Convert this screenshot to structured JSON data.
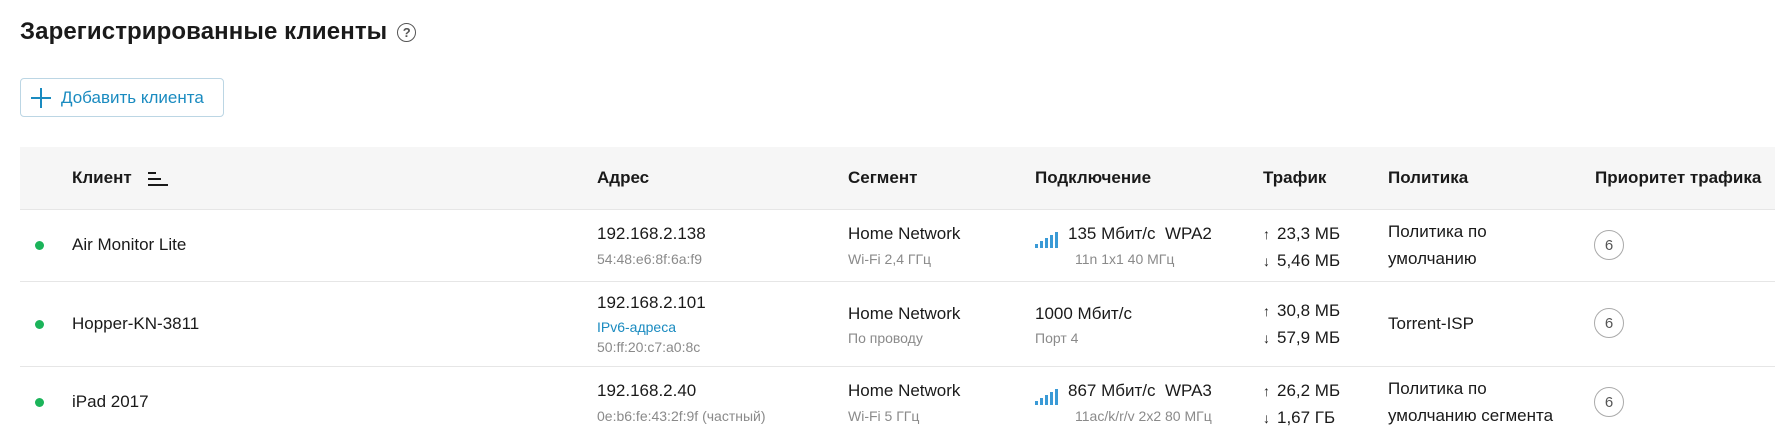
{
  "header": {
    "title": "Зарегистрированные клиенты",
    "help_icon": "question-circle-icon"
  },
  "toolbar": {
    "add_label": "Добавить клиента",
    "add_icon": "plus-icon"
  },
  "colors": {
    "accent": "#1a8bc0",
    "online": "#1bb45a",
    "signal": "#3a9ad6"
  },
  "columns": {
    "client": "Клиент",
    "address": "Адрес",
    "segment": "Сегмент",
    "connection": "Подключение",
    "traffic": "Трафик",
    "policy": "Политика",
    "priority": "Приоритет трафика"
  },
  "rows": [
    {
      "status": "online",
      "name": "Air Monitor Lite",
      "ip": "192.168.2.138",
      "mac": "54:48:e6:8f:6a:f9",
      "segment": "Home Network",
      "segment_sub": "Wi-Fi 2,4 ГГц",
      "speed": "135 Мбит/с",
      "security": "WPA2",
      "conn_sub": "11n 1x1 40 МГц",
      "up": "23,3 МБ",
      "down": "5,46 МБ",
      "policy_line1": "Политика по",
      "policy_line2": "умолчанию",
      "priority": "6"
    },
    {
      "status": "online",
      "name": "Hopper-KN-3811",
      "ip": "192.168.2.101",
      "ipv6_link": "IPv6-адреса",
      "mac": "50:ff:20:c7:a0:8c",
      "segment": "Home Network",
      "segment_sub": "По проводу",
      "speed": "1000 Мбит/с",
      "conn_sub": "Порт 4",
      "up": "30,8 МБ",
      "down": "57,9 МБ",
      "policy": "Torrent-ISP",
      "priority": "6"
    },
    {
      "status": "online",
      "name": "iPad 2017",
      "ip": "192.168.2.40",
      "mac": "0e:b6:fe:43:2f:9f (частный)",
      "segment": "Home Network",
      "segment_sub": "Wi-Fi 5 ГГц",
      "speed": "867 Мбит/с",
      "security": "WPA3",
      "conn_sub": "11ac/k/r/v 2x2 80 МГц",
      "up": "26,2 МБ",
      "down": "1,67 ГБ",
      "policy_line1": "Политика по",
      "policy_line2": "умолчанию сегмента",
      "priority": "6"
    }
  ]
}
